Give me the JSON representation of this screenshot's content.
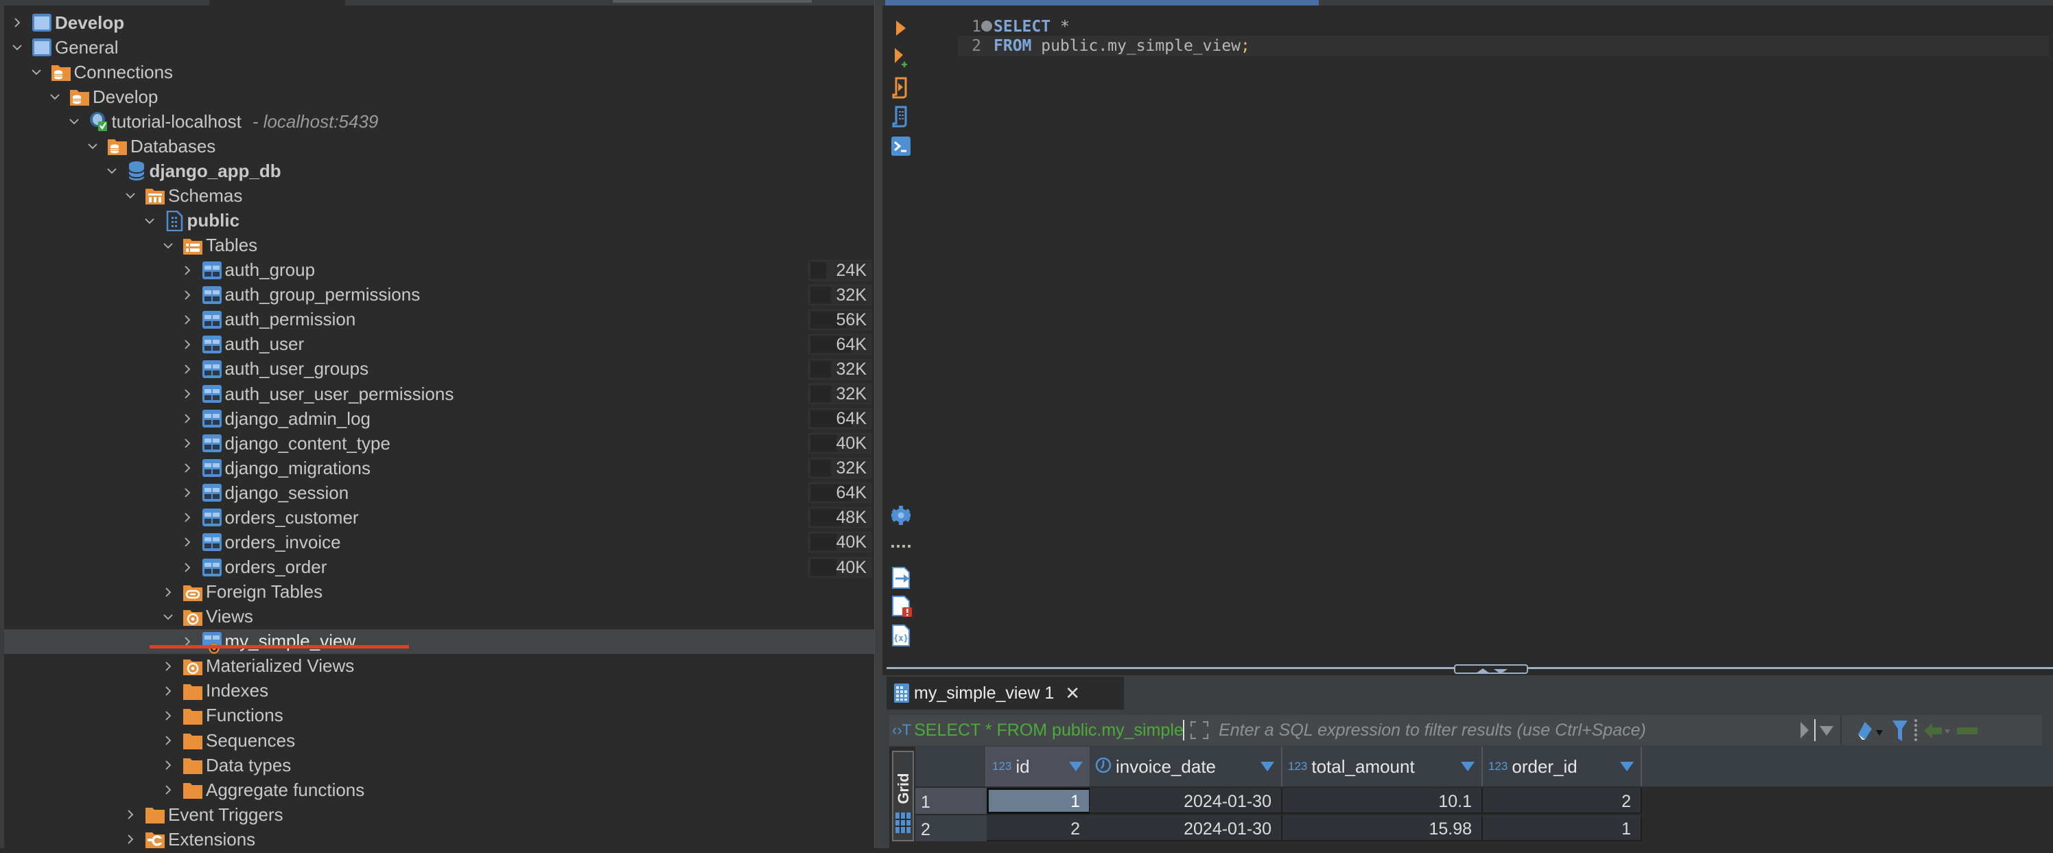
{
  "navigator": {
    "tree": [
      {
        "label": "Develop",
        "level": 0,
        "expanded": false,
        "icon": "folder-blue-icon",
        "bold": true
      },
      {
        "label": "General",
        "level": 0,
        "expanded": true,
        "icon": "folder-blue-icon"
      },
      {
        "label": "Connections",
        "level": 1,
        "expanded": true,
        "icon": "connections-folder-icon"
      },
      {
        "label": "Develop",
        "level": 2,
        "expanded": true,
        "icon": "connections-folder-icon"
      },
      {
        "label": "tutorial-localhost",
        "sublabel": "- localhost:5439",
        "level": 3,
        "expanded": true,
        "icon": "postgresql-connected-icon"
      },
      {
        "label": "Databases",
        "level": 4,
        "expanded": true,
        "icon": "connections-folder-icon"
      },
      {
        "label": "django_app_db",
        "level": 5,
        "expanded": true,
        "icon": "database-icon",
        "bold": true
      },
      {
        "label": "Schemas",
        "level": 6,
        "expanded": true,
        "icon": "schemas-folder-icon"
      },
      {
        "label": "public",
        "level": 7,
        "expanded": true,
        "icon": "schema-icon",
        "bold": true
      },
      {
        "label": "Tables",
        "level": 8,
        "expanded": true,
        "icon": "tables-folder-icon"
      },
      {
        "label": "auth_group",
        "level": 9,
        "expanded": false,
        "icon": "table-icon",
        "size": "24K"
      },
      {
        "label": "auth_group_permissions",
        "level": 9,
        "expanded": false,
        "icon": "table-icon",
        "size": "32K"
      },
      {
        "label": "auth_permission",
        "level": 9,
        "expanded": false,
        "icon": "table-icon",
        "size": "56K"
      },
      {
        "label": "auth_user",
        "level": 9,
        "expanded": false,
        "icon": "table-icon",
        "size": "64K"
      },
      {
        "label": "auth_user_groups",
        "level": 9,
        "expanded": false,
        "icon": "table-icon",
        "size": "32K"
      },
      {
        "label": "auth_user_user_permissions",
        "level": 9,
        "expanded": false,
        "icon": "table-icon",
        "size": "32K"
      },
      {
        "label": "django_admin_log",
        "level": 9,
        "expanded": false,
        "icon": "table-icon",
        "size": "64K"
      },
      {
        "label": "django_content_type",
        "level": 9,
        "expanded": false,
        "icon": "table-icon",
        "size": "40K"
      },
      {
        "label": "django_migrations",
        "level": 9,
        "expanded": false,
        "icon": "table-icon",
        "size": "32K"
      },
      {
        "label": "django_session",
        "level": 9,
        "expanded": false,
        "icon": "table-icon",
        "size": "64K"
      },
      {
        "label": "orders_customer",
        "level": 9,
        "expanded": false,
        "icon": "table-icon",
        "size": "48K"
      },
      {
        "label": "orders_invoice",
        "level": 9,
        "expanded": false,
        "icon": "table-icon",
        "size": "40K"
      },
      {
        "label": "orders_order",
        "level": 9,
        "expanded": false,
        "icon": "table-icon",
        "size": "40K"
      },
      {
        "label": "Foreign Tables",
        "level": 8,
        "expanded": false,
        "icon": "foreign-tables-folder-icon"
      },
      {
        "label": "Views",
        "level": 8,
        "expanded": true,
        "icon": "views-folder-icon"
      },
      {
        "label": "my_simple_view",
        "level": 9,
        "expanded": false,
        "icon": "view-icon",
        "selected": true
      },
      {
        "label": "Materialized Views",
        "level": 8,
        "expanded": false,
        "icon": "views-folder-icon"
      },
      {
        "label": "Indexes",
        "level": 8,
        "expanded": false,
        "icon": "folder-orange-icon"
      },
      {
        "label": "Functions",
        "level": 8,
        "expanded": false,
        "icon": "folder-orange-icon"
      },
      {
        "label": "Sequences",
        "level": 8,
        "expanded": false,
        "icon": "folder-orange-icon"
      },
      {
        "label": "Data types",
        "level": 8,
        "expanded": false,
        "icon": "folder-orange-icon"
      },
      {
        "label": "Aggregate functions",
        "level": 8,
        "expanded": false,
        "icon": "folder-orange-icon"
      },
      {
        "label": "Event Triggers",
        "level": 6,
        "expanded": false,
        "icon": "folder-orange-icon"
      },
      {
        "label": "Extensions",
        "level": 6,
        "expanded": false,
        "icon": "extensions-folder-icon"
      }
    ]
  },
  "editor": {
    "lines": [
      {
        "num": "1",
        "tokens": [
          {
            "t": "SELECT",
            "c": "kw"
          },
          {
            "t": " *",
            "c": "id"
          }
        ]
      },
      {
        "num": "2",
        "tokens": [
          {
            "t": "FROM",
            "c": "kw"
          },
          {
            "t": " public.my_simple_view",
            "c": "id"
          },
          {
            "t": ";",
            "c": "semi"
          }
        ]
      }
    ],
    "tools_top": [
      "execute-statement-icon",
      "execute-new-tab-icon",
      "execute-script-icon",
      "execute-script-new-tabs-icon",
      "open-terminal-icon"
    ],
    "tools_bottom": [
      "settings-gear-icon",
      "more-dots-icon",
      "export-results-icon",
      "show-errors-icon",
      "variables-icon"
    ]
  },
  "results": {
    "tab_label": "my_simple_view 1",
    "filter_query": "SELECT * FROM public.my_simple_view",
    "filter_placeholder": "Enter a SQL expression to filter results (use Ctrl+Space)",
    "grid_label": "Grid",
    "columns": [
      {
        "name": "id",
        "type": "123"
      },
      {
        "name": "invoice_date",
        "type": "clock"
      },
      {
        "name": "total_amount",
        "type": "123"
      },
      {
        "name": "order_id",
        "type": "123"
      }
    ],
    "rows": [
      {
        "num": "1",
        "cells": [
          "1",
          "2024-01-30",
          "10.1",
          "2"
        ]
      },
      {
        "num": "2",
        "cells": [
          "2",
          "2024-01-30",
          "15.98",
          "1"
        ]
      }
    ]
  },
  "colors": {
    "accent_blue": "#4f90d3",
    "folder_orange": "#e8903a",
    "selection_underline": "#e0402a",
    "filter_query_green": "#4caa3a"
  }
}
